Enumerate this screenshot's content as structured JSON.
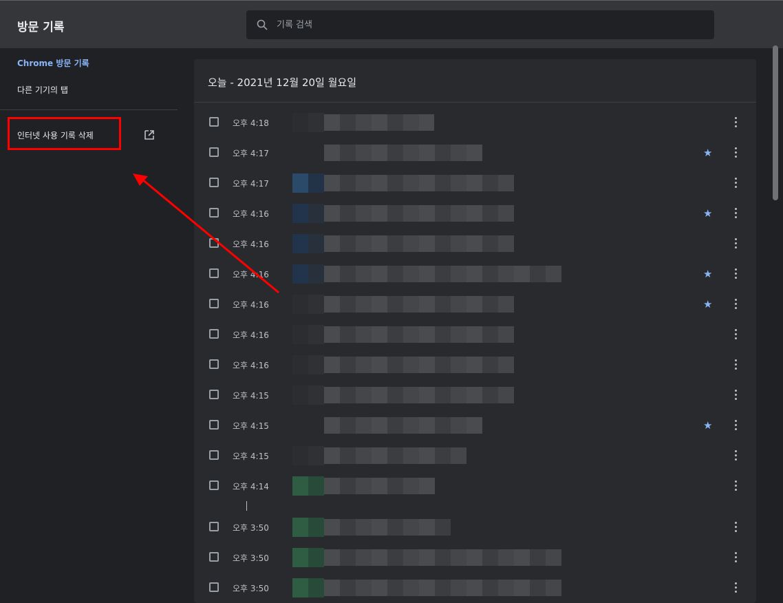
{
  "header": {
    "title": "방문 기록",
    "search_placeholder": "기록 검색"
  },
  "sidebar": {
    "items": [
      {
        "label": "Chrome 방문 기록",
        "active": true
      },
      {
        "label": "다른 기기의 탭",
        "active": false
      }
    ],
    "clear_link": "인터넷 사용 기록 삭제"
  },
  "main": {
    "date_heading": "오늘 - 2021년 12월 20일 월요일",
    "entries": [
      {
        "time": "오후 4:18",
        "starred": false
      },
      {
        "time": "오후 4:17",
        "starred": true
      },
      {
        "time": "오후 4:17",
        "starred": false
      },
      {
        "time": "오후 4:16",
        "starred": true
      },
      {
        "time": "오후 4:16",
        "starred": false
      },
      {
        "time": "오후 4:16",
        "starred": true
      },
      {
        "time": "오후 4:16",
        "starred": true
      },
      {
        "time": "오후 4:16",
        "starred": false
      },
      {
        "time": "오후 4:16",
        "starred": false
      },
      {
        "time": "오후 4:15",
        "starred": false
      },
      {
        "time": "오후 4:15",
        "starred": true
      },
      {
        "time": "오후 4:15",
        "starred": false
      },
      {
        "time": "오후 4:14",
        "starred": false
      },
      {
        "time": "오후 3:50",
        "starred": false
      },
      {
        "time": "오후 3:50",
        "starred": false
      },
      {
        "time": "오후 3:50",
        "starred": false
      }
    ]
  },
  "colors": {
    "background": "#202124",
    "header": "#35363a",
    "card": "#292a2d",
    "accent": "#8ab4f8",
    "annotation": "#ff0000"
  },
  "icons": {
    "search": "search-icon",
    "external_link": "open-in-new-icon",
    "star": "star-icon",
    "more": "more-vert-icon"
  }
}
